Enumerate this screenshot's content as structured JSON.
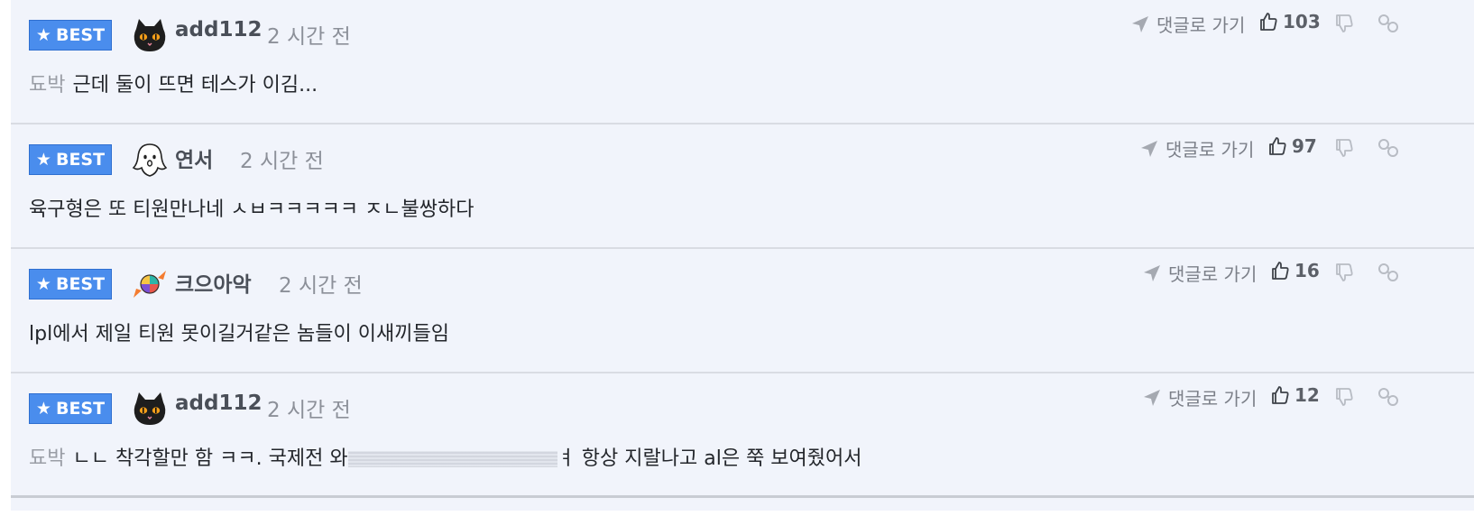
{
  "comments": [
    {
      "badge": "BEST",
      "avatar": "black-cat-icon",
      "nick": "add112",
      "time": "2 시간 전",
      "mention": "됴박",
      "text": "근데 둘이 뜨면 테스가 이김...",
      "goto_label": "댓글로 가기",
      "likes": "103"
    },
    {
      "badge": "BEST",
      "avatar": "ghost-icon",
      "nick": "연서",
      "time": "2 시간 전",
      "mention": "",
      "text": "육구형은 또 티원만나네 ㅅㅂㅋㅋㅋㅋㅋ ㅈㄴ불쌍하다",
      "goto_label": "댓글로 가기",
      "likes": "97"
    },
    {
      "badge": "BEST",
      "avatar": "candy-icon",
      "nick": "크으아악",
      "time": "2 시간 전",
      "mention": "",
      "text": "lpl에서 제일 티원 못이길거같은 놈들이 이새끼들임",
      "goto_label": "댓글로 가기",
      "likes": "16"
    },
    {
      "badge": "BEST",
      "avatar": "black-cat-icon",
      "nick": "add112",
      "time": "2 시간 전",
      "mention": "됴박",
      "text_before": "ㄴㄴ 착각할만 함 ㅋㅋ. 국제전 와",
      "text_after": "ㅕ 항상 지랄나고 al은 쭉 보여줬어서",
      "goto_label": "댓글로 가기",
      "likes": "12"
    }
  ],
  "colors": {
    "best_bg": "#4a8ded",
    "row_bg": "#f1f4fb",
    "divider": "#d9dce3"
  }
}
